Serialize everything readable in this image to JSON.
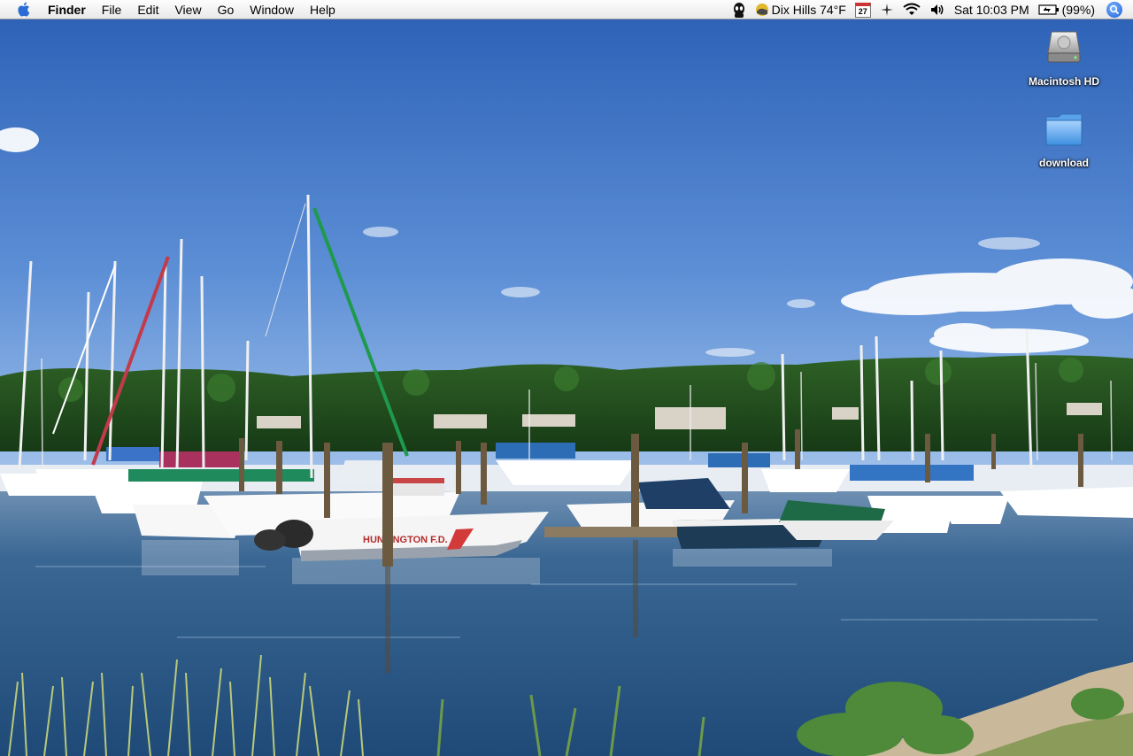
{
  "menubar": {
    "app_name": "Finder",
    "menus": [
      "File",
      "Edit",
      "View",
      "Go",
      "Window",
      "Help"
    ],
    "status": {
      "weather": "Dix Hills 74°F",
      "calendar_day": "27",
      "clock": "Sat 10:03 PM",
      "battery": "(99%)"
    }
  },
  "desktop": {
    "icons": [
      {
        "label": "Macintosh HD",
        "icon": "hard-drive-icon"
      },
      {
        "label": "download",
        "icon": "folder-icon"
      }
    ]
  },
  "wallpaper": {
    "subject": "marina-photo",
    "boat_lettering": "HUNTINGTON F.D."
  },
  "colors": {
    "sky_top": "#2d63b8",
    "sky_bottom": "#8fb6e6",
    "water": "#2b5685",
    "treeline": "#1f4a1d",
    "menubar": "#f2f2f2",
    "accent_blue": "#1d5fd6"
  }
}
